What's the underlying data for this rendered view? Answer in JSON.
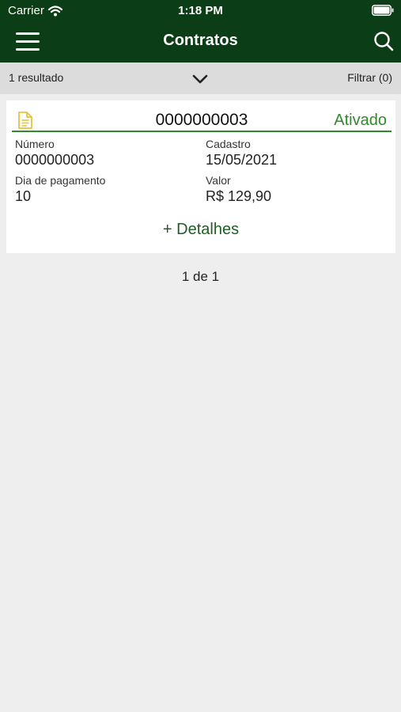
{
  "status_bar": {
    "carrier": "Carrier",
    "time": "1:18 PM"
  },
  "nav": {
    "title": "Contratos",
    "menu_icon": "hamburger-menu-icon",
    "search_icon": "search-icon"
  },
  "filter_bar": {
    "result_count": "1 resultado",
    "filter_label": "Filtrar (0)",
    "toggle_icon": "chevron-down-icon"
  },
  "contract": {
    "header_number": "0000000003",
    "status": "Ativado",
    "fields": {
      "numero_label": "Número",
      "numero_value": "0000000003",
      "cadastro_label": "Cadastro",
      "cadastro_value": "15/05/2021",
      "dia_label": "Dia de pagamento",
      "dia_value": "10",
      "valor_label": "Valor",
      "valor_value": "R$ 129,90"
    },
    "details_link": "+ Detalhes"
  },
  "pagination": "1 de 1",
  "colors": {
    "header_bg": "#0b3d16",
    "accent_green": "#2f8a2a",
    "doc_icon": "#e8c43a",
    "background": "#eeeeee"
  }
}
